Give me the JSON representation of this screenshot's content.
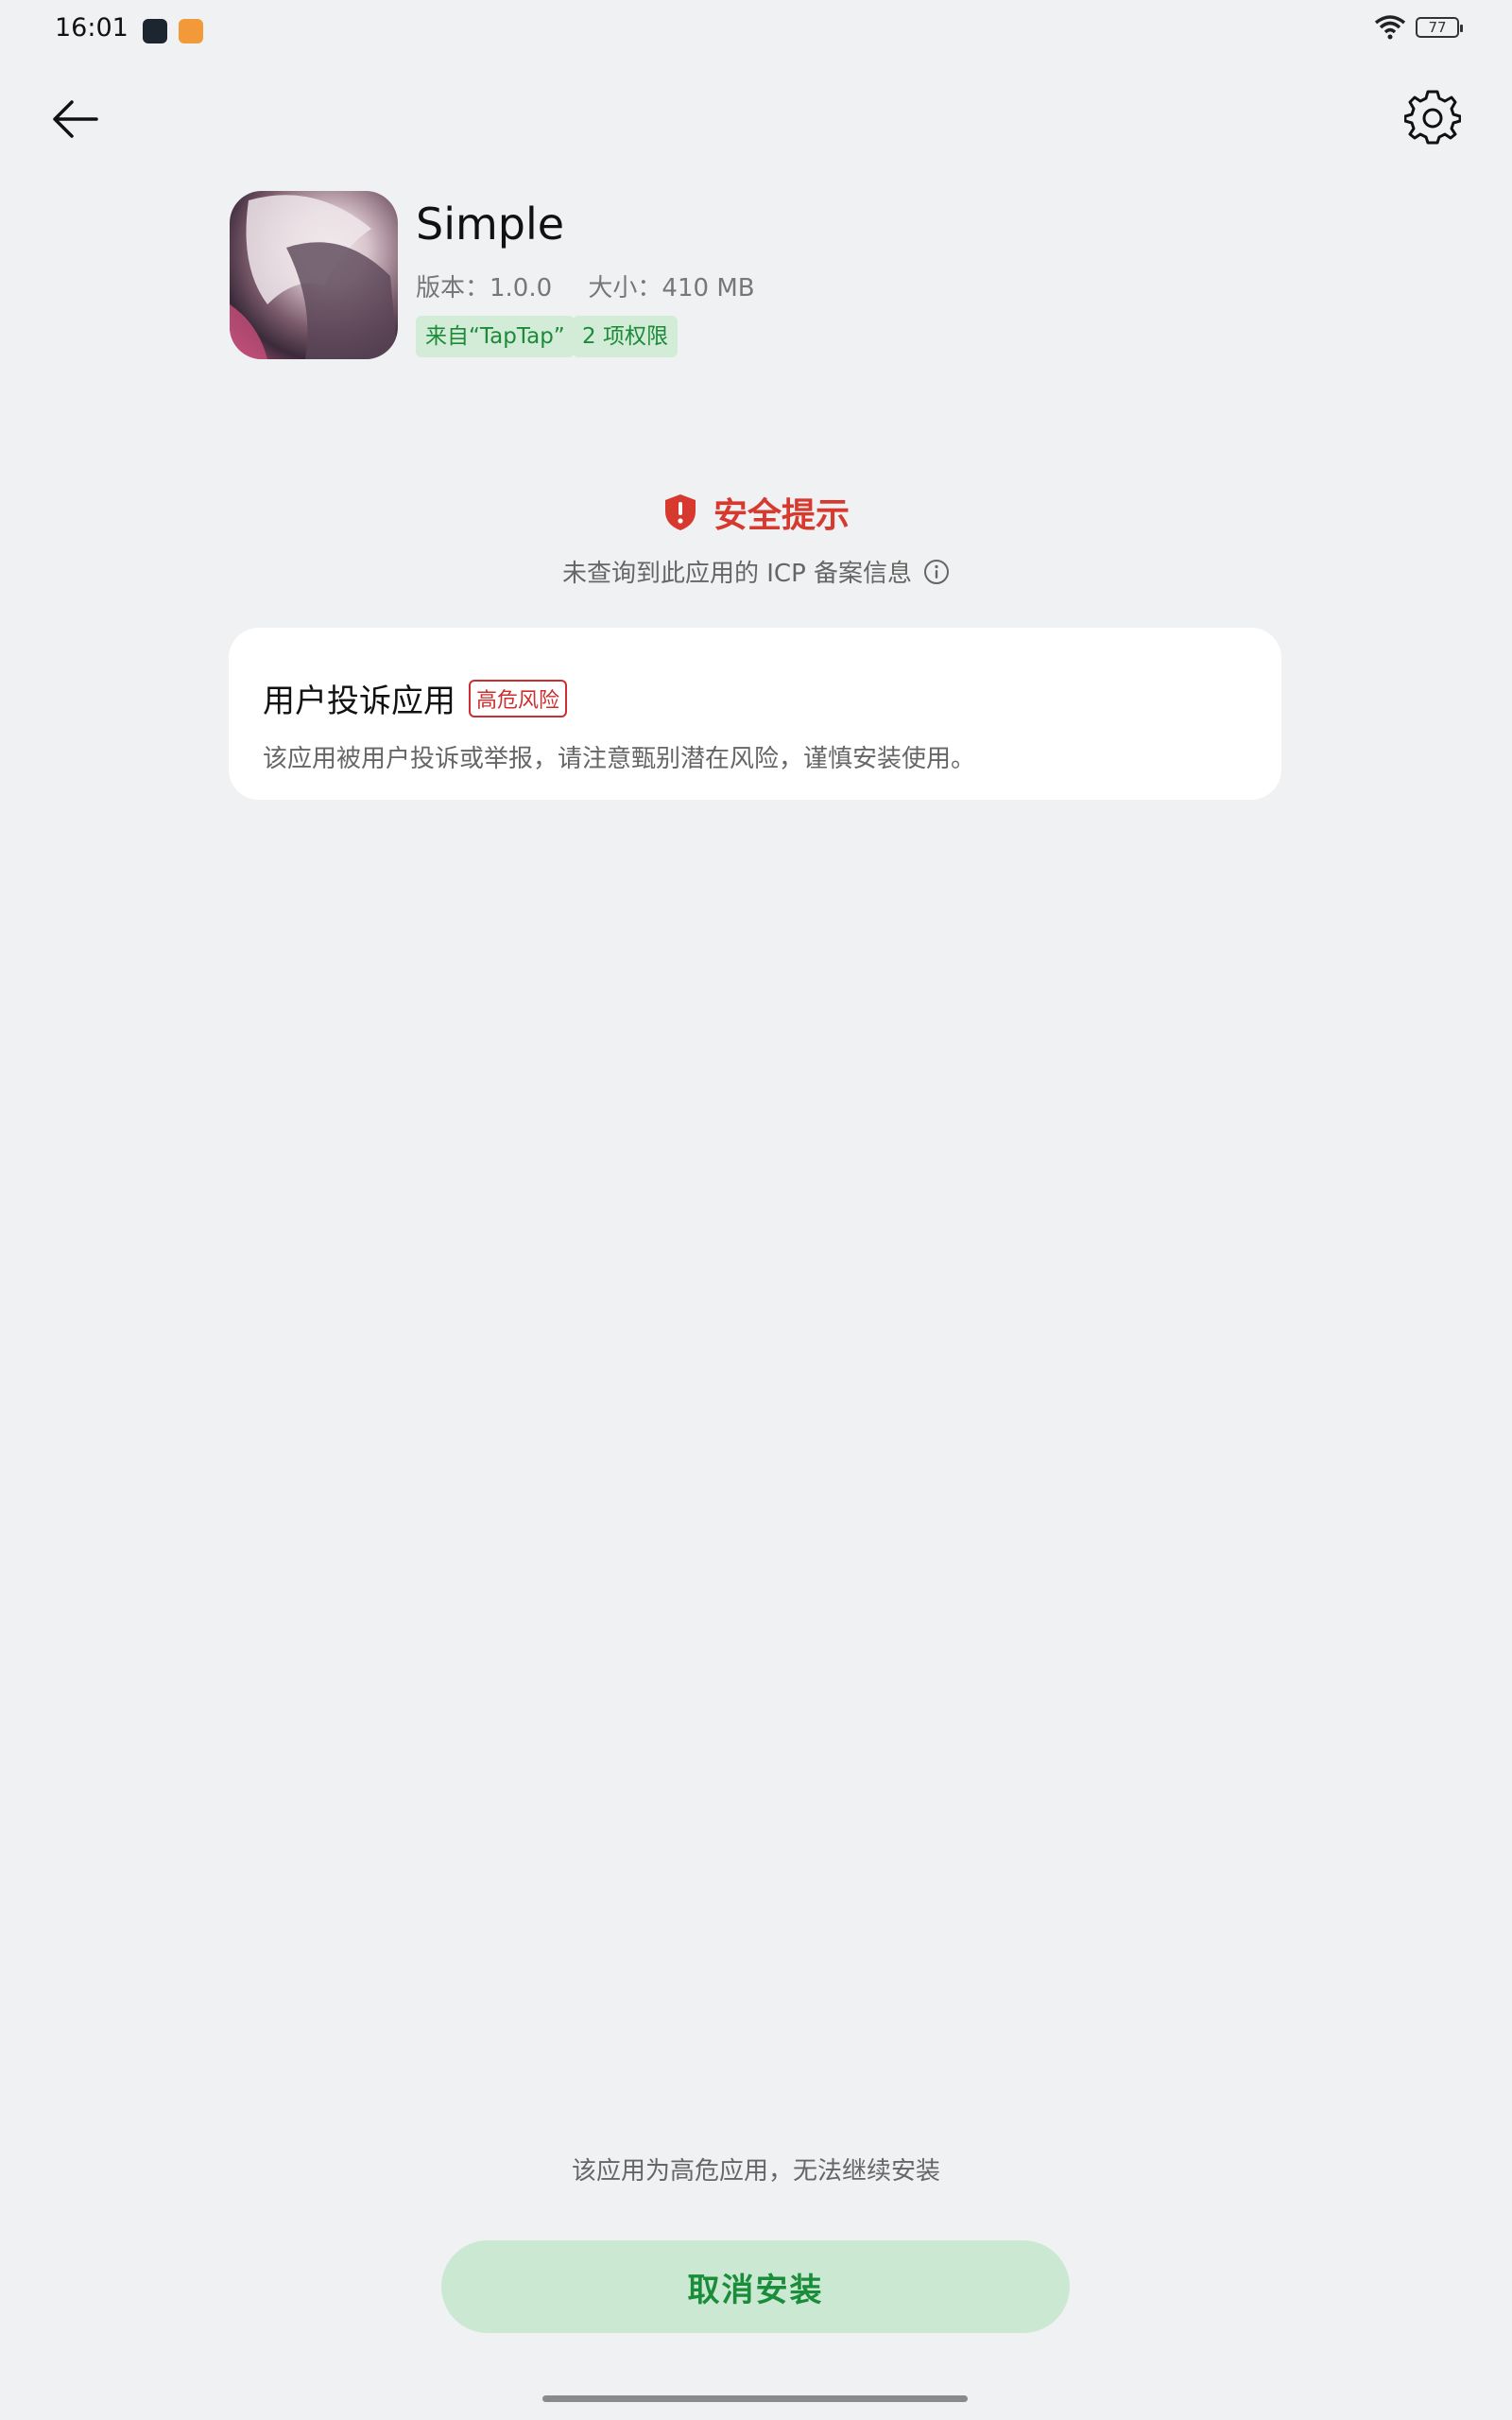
{
  "status_bar": {
    "time": "16:01",
    "battery": "77",
    "icons": [
      "app-notification-icon",
      "video-app-notification-icon",
      "wifi-icon",
      "battery-icon"
    ]
  },
  "nav": {
    "back_icon": "arrow-left-icon",
    "settings_icon": "gear-icon"
  },
  "app": {
    "name": "Simple",
    "version": "版本：1.0.0",
    "size": "大小：410 MB",
    "source_tag": "来自“TapTap”",
    "permissions_tag": "2 项权限"
  },
  "security": {
    "title": "安全提示",
    "subtitle": "未查询到此应用的 ICP 备案信息",
    "title_color": "#d63a2f"
  },
  "risk_card": {
    "title": "用户投诉应用",
    "badge": "高危风险",
    "description": "该应用被用户投诉或举报，请注意甄别潜在风险，谨慎安装使用。"
  },
  "footer": {
    "note": "该应用为高危应用，无法继续安装",
    "cancel_label": "取消安装",
    "accent": "#1a8d3a"
  }
}
